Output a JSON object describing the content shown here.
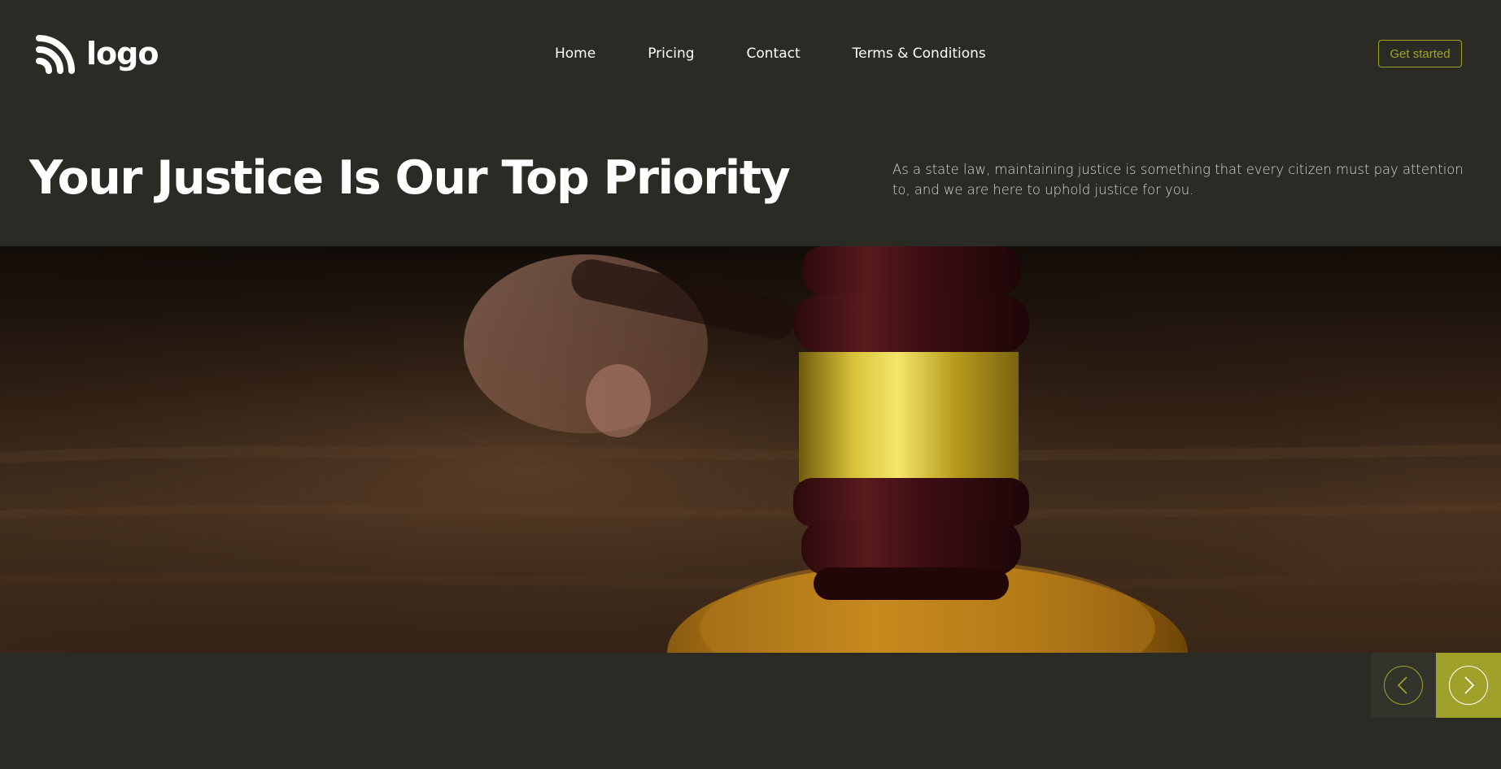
{
  "brand": {
    "logo_text": "logo"
  },
  "nav": {
    "items": [
      {
        "label": "Home"
      },
      {
        "label": "Pricing"
      },
      {
        "label": "Contact"
      },
      {
        "label": "Terms & Conditions"
      }
    ],
    "cta_label": "Get started"
  },
  "hero": {
    "title": "Your Justice Is Our Top Priority",
    "description": "As a state law, maintaining justice is something that every citizen must pay attention to, and we are here to uphold justice for you.",
    "image_icon": "gavel-image"
  },
  "slider": {
    "prev_icon": "chevron-left-icon",
    "next_icon": "chevron-right-icon"
  },
  "colors": {
    "background": "#2a2b24",
    "accent": "#a3a327",
    "accent_fill": "#a0a12a",
    "text": "#ffffff",
    "muted_text": "#d6d6cf"
  }
}
